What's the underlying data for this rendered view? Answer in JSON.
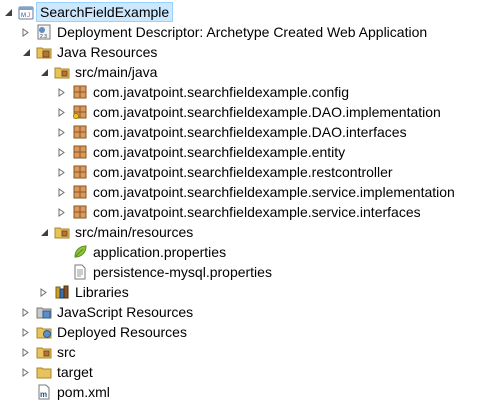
{
  "tree": {
    "root": "SearchFieldExample",
    "deployment_descriptor": "Deployment Descriptor: Archetype Created Web Application",
    "java_resources": "Java Resources",
    "src_main_java": "src/main/java",
    "packages": [
      "com.javatpoint.searchfieldexample.config",
      "com.javatpoint.searchfieldexample.DAO.implementation",
      "com.javatpoint.searchfieldexample.DAO.interfaces",
      "com.javatpoint.searchfieldexample.entity",
      "com.javatpoint.searchfieldexample.restcontroller",
      "com.javatpoint.searchfieldexample.service.implementation",
      "com.javatpoint.searchfieldexample.service.interfaces"
    ],
    "src_main_resources": "src/main/resources",
    "application_properties": "application.properties",
    "persistence_properties": "persistence-mysql.properties",
    "libraries": "Libraries",
    "javascript_resources": "JavaScript Resources",
    "deployed_resources": "Deployed Resources",
    "src": "src",
    "target": "target",
    "pom": "pom.xml"
  },
  "icons": {
    "project": "maven-project-icon",
    "descriptor": "web-descriptor-icon",
    "java_resources": "java-resources-icon",
    "source_folder": "source-folder-icon",
    "package": "package-icon",
    "properties": "properties-file-icon",
    "text_file": "text-file-icon",
    "libraries": "libraries-icon",
    "js_resources": "javascript-resources-icon",
    "deployed": "deployed-resources-icon",
    "folder": "folder-icon",
    "pom": "maven-pom-icon"
  },
  "colors": {
    "selection_bg": "#cce8ff",
    "selection_border": "#99d1ff",
    "package_brown": "#b5733a",
    "folder_yellow": "#e8c25a"
  }
}
